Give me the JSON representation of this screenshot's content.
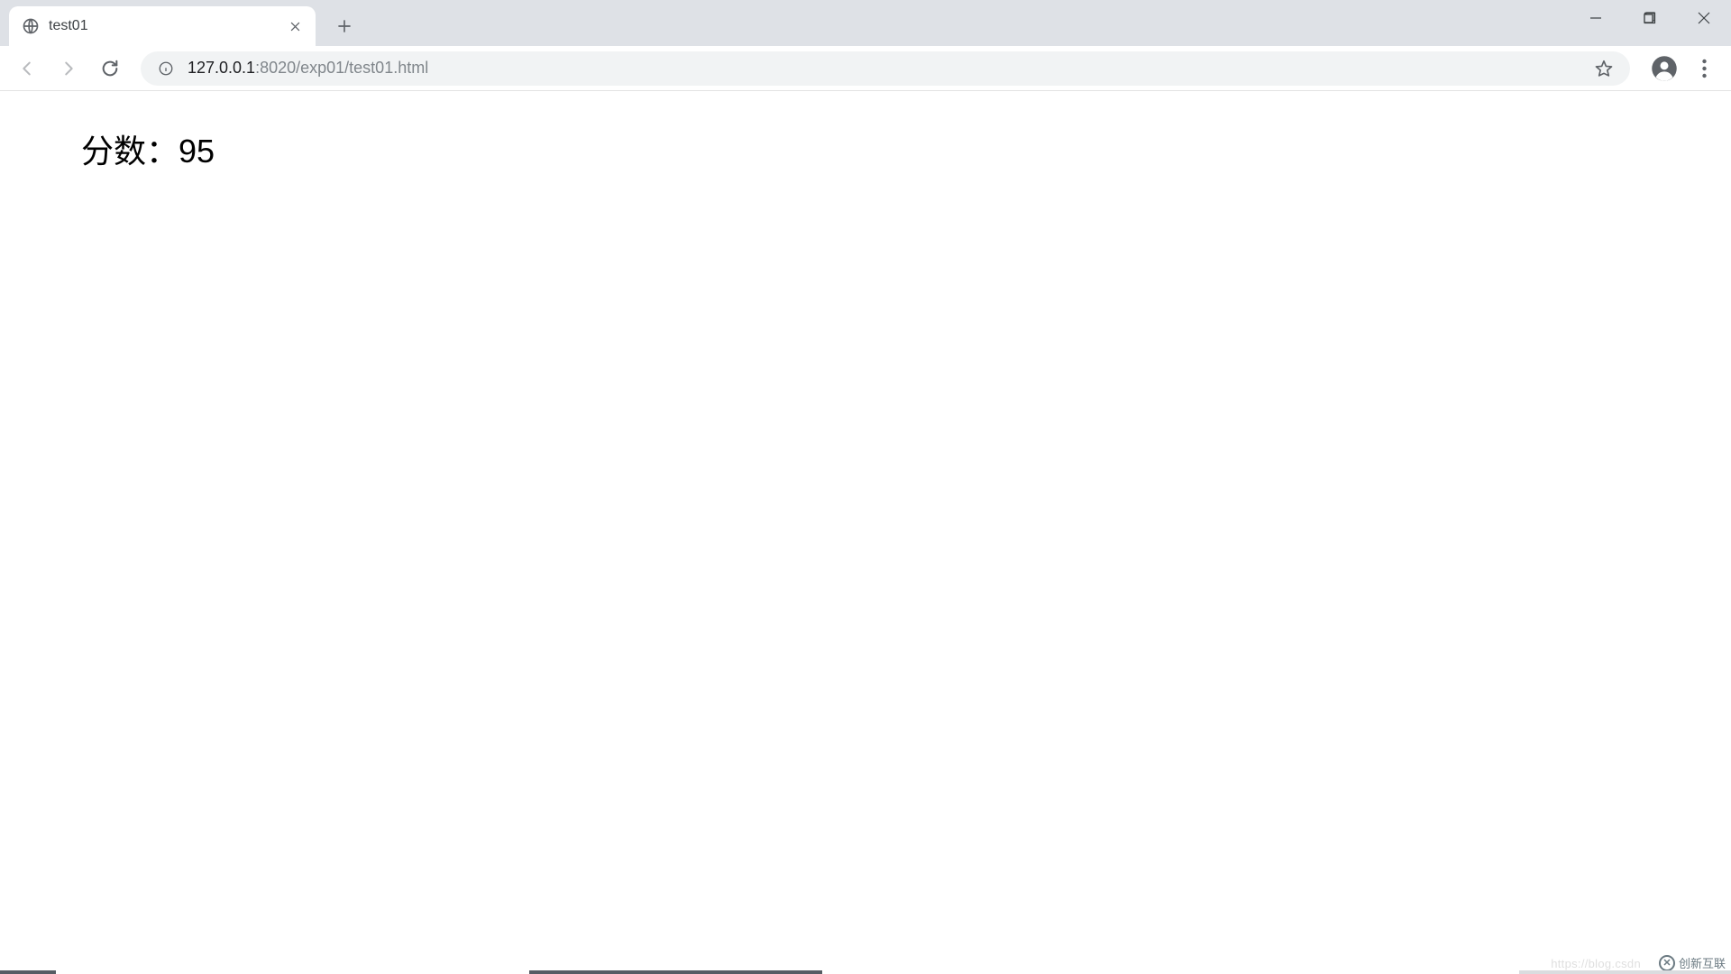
{
  "browser": {
    "tab_title": "test01",
    "url_host": "127.0.0.1",
    "url_rest": ":8020/exp01/test01.html"
  },
  "page": {
    "score_label": "分数：",
    "score_value": "95"
  },
  "watermark": {
    "link_text": "https://blog.csdn",
    "brand_text": "创新互联"
  }
}
